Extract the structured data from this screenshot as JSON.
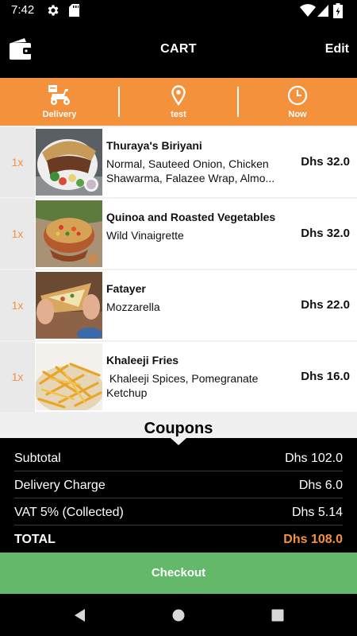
{
  "status_bar": {
    "time": "7:42",
    "icons": [
      "gear-icon",
      "sd-card-icon",
      "wifi-icon",
      "signal-icon",
      "battery-icon"
    ]
  },
  "app_bar": {
    "title": "CART",
    "edit_label": "Edit",
    "left_icon": "wallet-icon"
  },
  "order_options": {
    "delivery_label": "Delivery",
    "location_label": "test",
    "time_label": "Now"
  },
  "cart_items": [
    {
      "qty": "1x",
      "name": "Thuraya's Biriyani",
      "desc": "Normal, Sauteed Onion, Chicken Shawarma, Falazee Wrap, Almo...",
      "price": "Dhs 32.0",
      "image": "shawarma-plate"
    },
    {
      "qty": "1x",
      "name": "Quinoa and Roasted Vegetables",
      "desc": "Wild Vinaigrette",
      "price": "Dhs 32.0",
      "image": "quinoa-bowl"
    },
    {
      "qty": "1x",
      "name": "Fatayer",
      "desc": "Mozzarella",
      "price": "Dhs 22.0",
      "image": "fatayer-pastry"
    },
    {
      "qty": "1x",
      "name": "Khaleeji Fries",
      "desc": " Khaleeji Spices, Pomegranate Ketchup",
      "price": "Dhs 16.0",
      "image": "fries"
    }
  ],
  "coupons_label": "Coupons",
  "summary": {
    "subtotal_label": "Subtotal",
    "subtotal_value": "Dhs 102.0",
    "delivery_label": "Delivery Charge",
    "delivery_value": "Dhs 6.0",
    "vat_label": "VAT 5% (Collected)",
    "vat_value": "Dhs 5.14",
    "total_label": "TOTAL",
    "total_value": "Dhs 108.0"
  },
  "checkout_label": "Checkout",
  "colors": {
    "accent_orange": "#f4913c",
    "checkout_green": "#63b86a",
    "background_black": "#000000",
    "list_bg": "#f0f0f0"
  }
}
